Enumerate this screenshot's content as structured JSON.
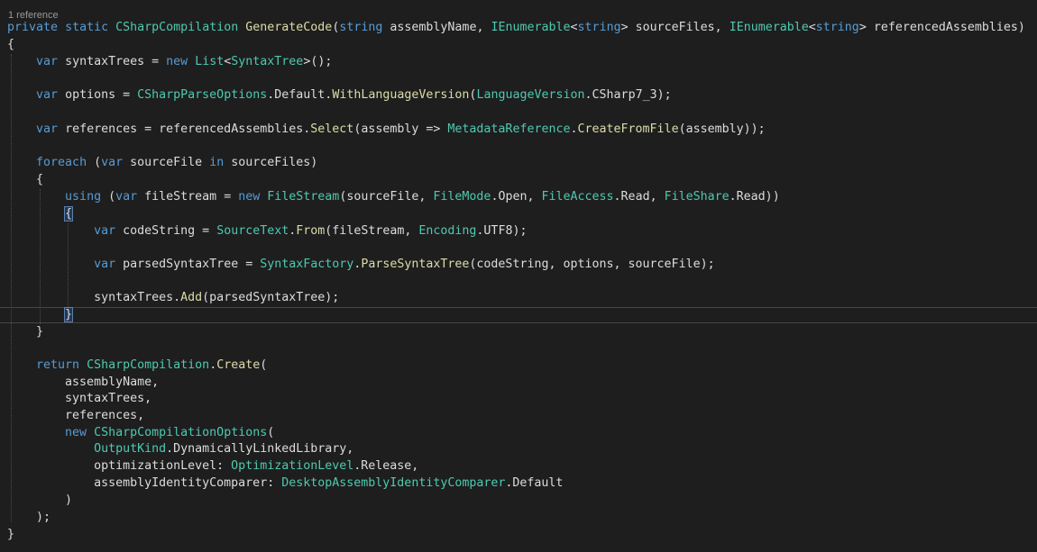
{
  "editor": {
    "codelens_label": "1 reference",
    "language": "C#",
    "colors": {
      "background": "#1e1e1e",
      "keyword": "#569cd6",
      "type": "#4ec9b0",
      "method": "#dcdcaa",
      "identifier": "#dcdcdc"
    },
    "lines": [
      [
        [
          "kw",
          "private"
        ],
        [
          "id",
          " "
        ],
        [
          "kw",
          "static"
        ],
        [
          "id",
          " "
        ],
        [
          "ty",
          "CSharpCompilation"
        ],
        [
          "id",
          " "
        ],
        [
          "mt",
          "GenerateCode"
        ],
        [
          "id",
          "("
        ],
        [
          "kw",
          "string"
        ],
        [
          "id",
          " assemblyName, "
        ],
        [
          "ty",
          "IEnumerable"
        ],
        [
          "id",
          "<"
        ],
        [
          "kw",
          "string"
        ],
        [
          "id",
          "> sourceFiles, "
        ],
        [
          "ty",
          "IEnumerable"
        ],
        [
          "id",
          "<"
        ],
        [
          "kw",
          "string"
        ],
        [
          "id",
          "> referencedAssemblies)"
        ]
      ],
      [
        [
          "id",
          "{"
        ]
      ],
      [
        [
          "id",
          "    "
        ],
        [
          "kw",
          "var"
        ],
        [
          "id",
          " syntaxTrees = "
        ],
        [
          "kw",
          "new"
        ],
        [
          "id",
          " "
        ],
        [
          "ty",
          "List"
        ],
        [
          "id",
          "<"
        ],
        [
          "ty",
          "SyntaxTree"
        ],
        [
          "id",
          ">();"
        ]
      ],
      [],
      [
        [
          "id",
          "    "
        ],
        [
          "kw",
          "var"
        ],
        [
          "id",
          " options = "
        ],
        [
          "ty",
          "CSharpParseOptions"
        ],
        [
          "id",
          "."
        ],
        [
          "id",
          "Default"
        ],
        [
          "id",
          "."
        ],
        [
          "mt",
          "WithLanguageVersion"
        ],
        [
          "id",
          "("
        ],
        [
          "ty",
          "LanguageVersion"
        ],
        [
          "id",
          ".CSharp7_3);"
        ]
      ],
      [],
      [
        [
          "id",
          "    "
        ],
        [
          "kw",
          "var"
        ],
        [
          "id",
          " references = referencedAssemblies."
        ],
        [
          "mt",
          "Select"
        ],
        [
          "id",
          "(assembly => "
        ],
        [
          "ty",
          "MetadataReference"
        ],
        [
          "id",
          "."
        ],
        [
          "mt",
          "CreateFromFile"
        ],
        [
          "id",
          "(assembly));"
        ]
      ],
      [],
      [
        [
          "id",
          "    "
        ],
        [
          "kw",
          "foreach"
        ],
        [
          "id",
          " ("
        ],
        [
          "kw",
          "var"
        ],
        [
          "id",
          " sourceFile "
        ],
        [
          "kw",
          "in"
        ],
        [
          "id",
          " sourceFiles)"
        ]
      ],
      [
        [
          "id",
          "    {"
        ]
      ],
      [
        [
          "id",
          "        "
        ],
        [
          "kw",
          "using"
        ],
        [
          "id",
          " ("
        ],
        [
          "kw",
          "var"
        ],
        [
          "id",
          " fileStream = "
        ],
        [
          "kw",
          "new"
        ],
        [
          "id",
          " "
        ],
        [
          "ty",
          "FileStream"
        ],
        [
          "id",
          "(sourceFile, "
        ],
        [
          "ty",
          "FileMode"
        ],
        [
          "id",
          ".Open, "
        ],
        [
          "ty",
          "FileAccess"
        ],
        [
          "id",
          ".Read, "
        ],
        [
          "ty",
          "FileShare"
        ],
        [
          "id",
          ".Read))"
        ]
      ],
      [
        [
          "id",
          "        "
        ],
        [
          "hl",
          "{"
        ]
      ],
      [
        [
          "id",
          "            "
        ],
        [
          "kw",
          "var"
        ],
        [
          "id",
          " codeString = "
        ],
        [
          "ty",
          "SourceText"
        ],
        [
          "id",
          "."
        ],
        [
          "mt",
          "From"
        ],
        [
          "id",
          "(fileStream, "
        ],
        [
          "ty",
          "Encoding"
        ],
        [
          "id",
          ".UTF8);"
        ]
      ],
      [],
      [
        [
          "id",
          "            "
        ],
        [
          "kw",
          "var"
        ],
        [
          "id",
          " parsedSyntaxTree = "
        ],
        [
          "ty",
          "SyntaxFactory"
        ],
        [
          "id",
          "."
        ],
        [
          "mt",
          "ParseSyntaxTree"
        ],
        [
          "id",
          "(codeString, options, sourceFile);"
        ]
      ],
      [],
      [
        [
          "id",
          "            syntaxTrees."
        ],
        [
          "mt",
          "Add"
        ],
        [
          "id",
          "(parsedSyntaxTree);"
        ]
      ],
      [
        [
          "id",
          "        "
        ],
        [
          "hl",
          "}"
        ]
      ],
      [
        [
          "id",
          "    }"
        ]
      ],
      [],
      [
        [
          "id",
          "    "
        ],
        [
          "kw",
          "return"
        ],
        [
          "id",
          " "
        ],
        [
          "ty",
          "CSharpCompilation"
        ],
        [
          "id",
          "."
        ],
        [
          "mt",
          "Create"
        ],
        [
          "id",
          "("
        ]
      ],
      [
        [
          "id",
          "        assemblyName,"
        ]
      ],
      [
        [
          "id",
          "        syntaxTrees,"
        ]
      ],
      [
        [
          "id",
          "        references,"
        ]
      ],
      [
        [
          "id",
          "        "
        ],
        [
          "kw",
          "new"
        ],
        [
          "id",
          " "
        ],
        [
          "ty",
          "CSharpCompilationOptions"
        ],
        [
          "id",
          "("
        ]
      ],
      [
        [
          "id",
          "            "
        ],
        [
          "ty",
          "OutputKind"
        ],
        [
          "id",
          ".DynamicallyLinkedLibrary,"
        ]
      ],
      [
        [
          "id",
          "            optimizationLevel: "
        ],
        [
          "ty",
          "OptimizationLevel"
        ],
        [
          "id",
          ".Release,"
        ]
      ],
      [
        [
          "id",
          "            assemblyIdentityComparer: "
        ],
        [
          "ty",
          "DesktopAssemblyIdentityComparer"
        ],
        [
          "id",
          ".Default"
        ]
      ],
      [
        [
          "id",
          "        )"
        ]
      ],
      [
        [
          "id",
          "    );"
        ]
      ],
      [
        [
          "id",
          "}"
        ]
      ]
    ]
  }
}
